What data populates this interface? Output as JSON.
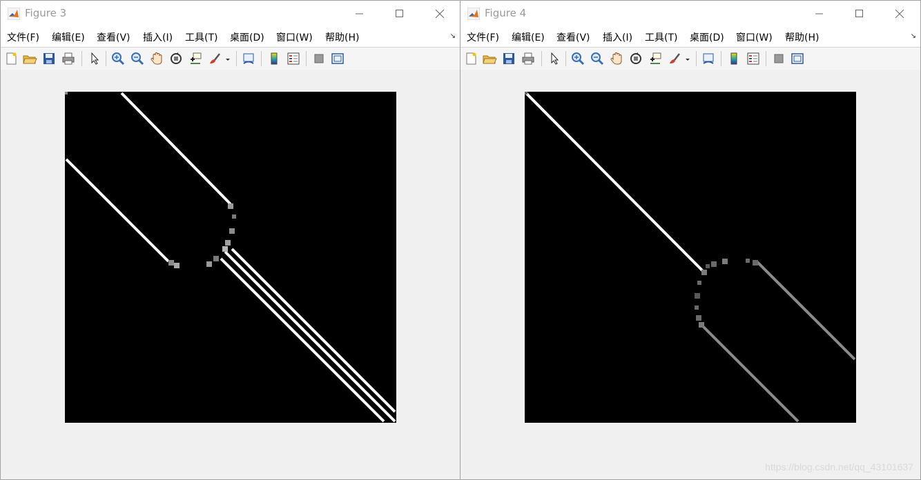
{
  "windows": [
    {
      "title": "Figure 3",
      "menu": [
        "文件(F)",
        "编辑(E)",
        "查看(V)",
        "插入(I)",
        "工具(T)",
        "桌面(D)",
        "窗口(W)",
        "帮助(H)"
      ]
    },
    {
      "title": "Figure 4",
      "menu": [
        "文件(F)",
        "编辑(E)",
        "查看(V)",
        "插入(I)",
        "工具(T)",
        "桌面(D)",
        "窗口(W)",
        "帮助(H)"
      ],
      "watermark": "https://blog.csdn.net/qq_43101637"
    }
  ],
  "colors": {
    "titlebar_bg": "#ffffff",
    "title_text": "#9a9a9a",
    "plot_bg": "#000000",
    "edge_bright": "#ffffff",
    "edge_dim": "#8a8a8a"
  }
}
